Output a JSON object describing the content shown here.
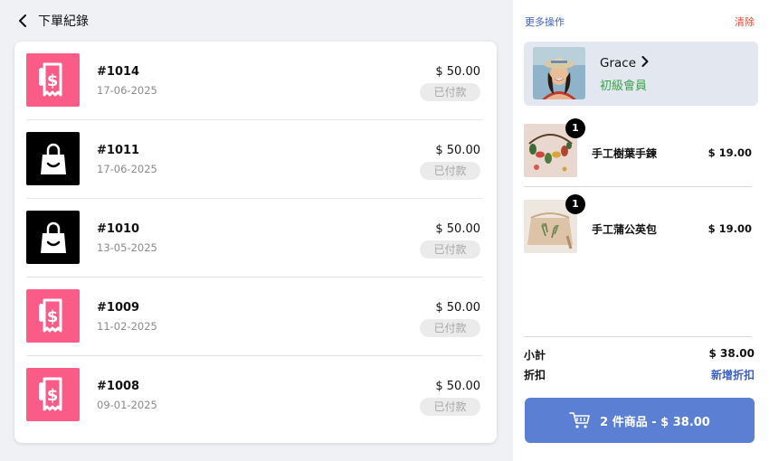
{
  "header": {
    "title": "下單紀錄"
  },
  "orders": [
    {
      "number": "#1014",
      "date": "17-06-2025",
      "amount": "$ 50.00",
      "status": "已付款",
      "icon": "receipt-icon"
    },
    {
      "number": "#1011",
      "date": "17-06-2025",
      "amount": "$ 50.00",
      "status": "已付款",
      "icon": "shopping-bag-icon"
    },
    {
      "number": "#1010",
      "date": "13-05-2025",
      "amount": "$ 50.00",
      "status": "已付款",
      "icon": "shopping-bag-icon"
    },
    {
      "number": "#1009",
      "date": "11-02-2025",
      "amount": "$ 50.00",
      "status": "已付款",
      "icon": "receipt-icon"
    },
    {
      "number": "#1008",
      "date": "09-01-2025",
      "amount": "$ 50.00",
      "status": "已付款",
      "icon": "receipt-icon"
    }
  ],
  "cart": {
    "more_actions": "更多操作",
    "clear": "清除",
    "customer": {
      "name": "Grace",
      "level": "初級會員"
    },
    "items": [
      {
        "name": "手工樹葉手鍊",
        "price": "$ 19.00",
        "qty": "1"
      },
      {
        "name": "手工蒲公英包",
        "price": "$ 19.00",
        "qty": "1"
      }
    ],
    "subtotal_label": "小計",
    "subtotal": "$ 38.00",
    "discount_label": "折扣",
    "discount_action": "新增折扣",
    "checkout_label": "2 件商品 - $ 38.00"
  },
  "colors": {
    "accent_pink": "#fb5b87",
    "accent_blue": "#5b7fd3",
    "link_blue": "#3b5fc4",
    "danger_red": "#e04b3c",
    "member_green": "#3aa24b"
  }
}
